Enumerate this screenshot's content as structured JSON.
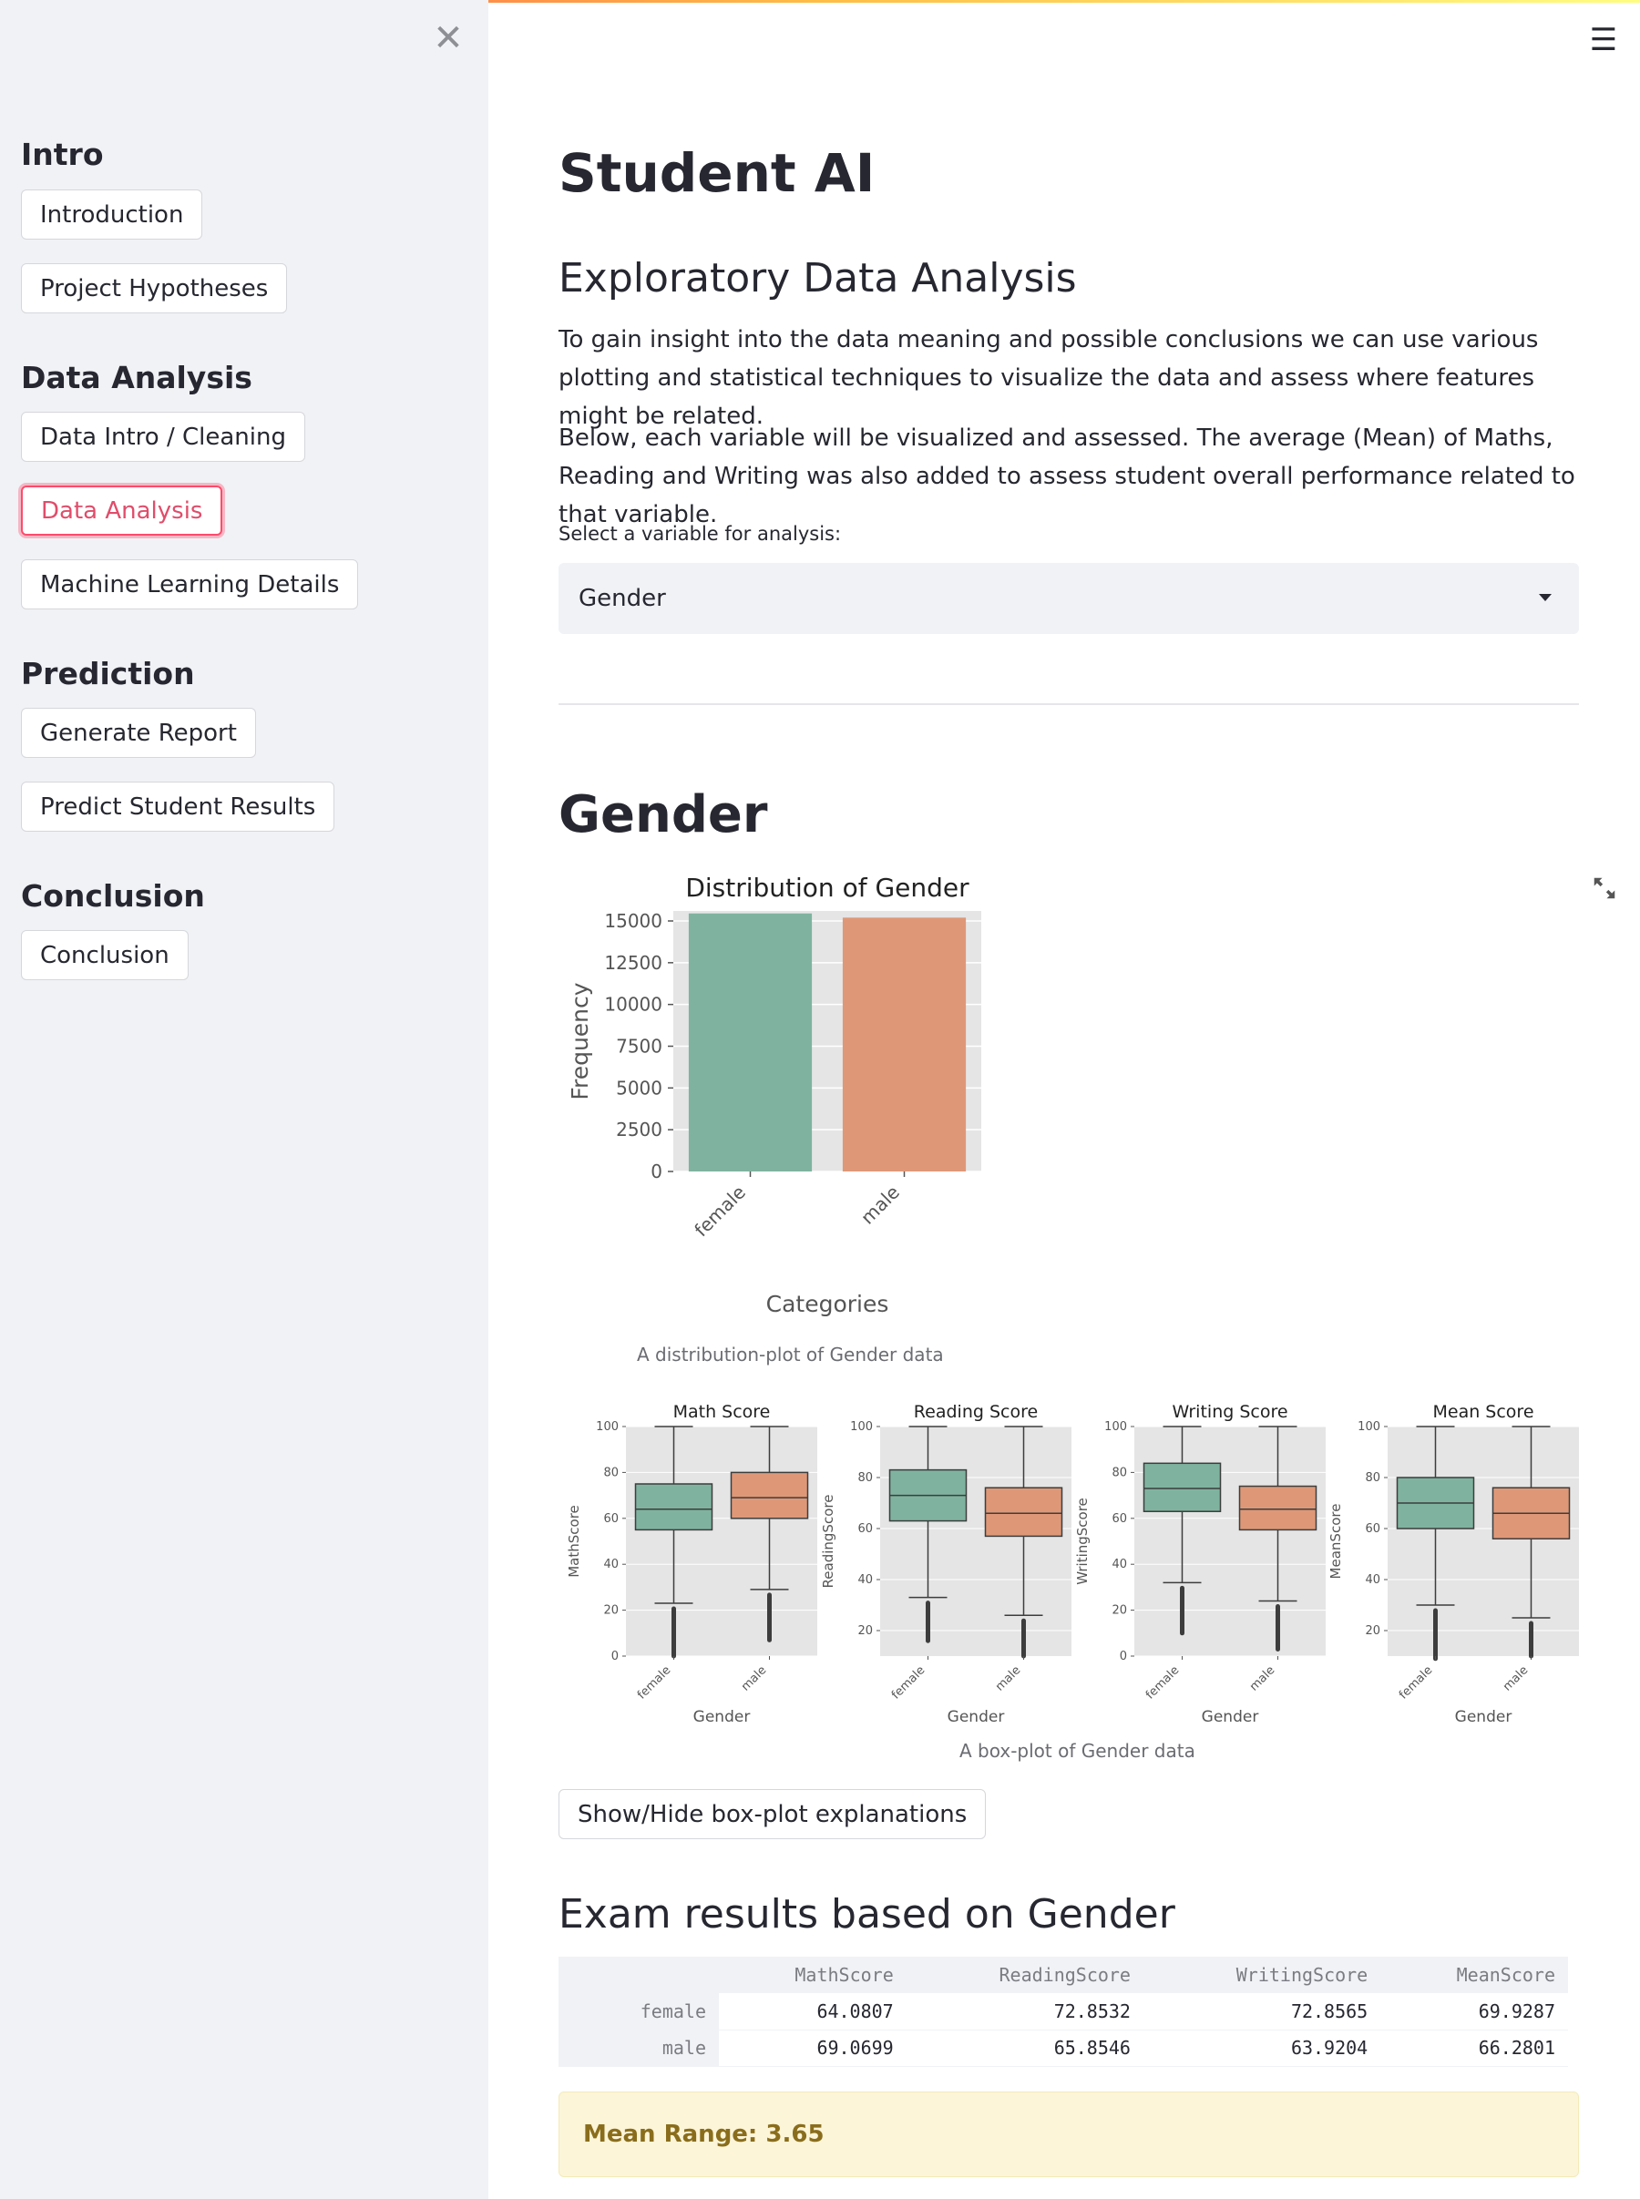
{
  "sidebar": {
    "sections": [
      {
        "heading": "Intro",
        "buttons": [
          "Introduction",
          "Project Hypotheses"
        ]
      },
      {
        "heading": "Data Analysis",
        "buttons": [
          "Data Intro / Cleaning",
          "Data Analysis",
          "Machine Learning Details"
        ]
      },
      {
        "heading": "Prediction",
        "buttons": [
          "Generate Report",
          "Predict Student Results"
        ]
      },
      {
        "heading": "Conclusion",
        "buttons": [
          "Conclusion"
        ]
      }
    ],
    "active_button": "Data Analysis"
  },
  "icons": {
    "close": "close-icon",
    "menu": "hamburger-icon",
    "expand": "fullscreen-icon"
  },
  "main": {
    "title": "Student AI",
    "subtitle": "Exploratory Data Analysis",
    "para1": "To gain insight into the data meaning and possible conclusions we can use various plotting and statistical techniques to visualize the data and assess where features might be related.",
    "para2": "Below, each variable will be visualized and assessed. The average (Mean) of Maths, Reading and Writing was also added to assess student overall performance related to that variable.",
    "select_label": "Select a variable for analysis:",
    "select_value": "Gender",
    "section_title": "Gender",
    "dist_caption": "A distribution-plot of Gender data",
    "box_caption": "A box-plot of Gender data",
    "toggle_button": "Show/Hide box-plot explanations",
    "results_title": "Exam results based on Gender",
    "table": {
      "columns": [
        "MathScore",
        "ReadingScore",
        "WritingScore",
        "MeanScore"
      ],
      "rows": [
        {
          "index": "female",
          "values": [
            "64.0807",
            "72.8532",
            "72.8565",
            "69.9287"
          ]
        },
        {
          "index": "male",
          "values": [
            "69.0699",
            "65.8546",
            "63.9204",
            "66.2801"
          ]
        }
      ]
    },
    "alert": "Mean Range: 3.65"
  },
  "colors": {
    "female": "#7fb3a0",
    "male": "#de9878",
    "accent": "#ff4b4b"
  },
  "chart_data": [
    {
      "type": "bar",
      "title": "Distribution of Gender",
      "xlabel": "Categories",
      "ylabel": "Frequency",
      "categories": [
        "female",
        "male"
      ],
      "values": [
        15450,
        15200
      ],
      "ylim": [
        0,
        15600
      ],
      "yticks": [
        "0",
        "2500",
        "5000",
        "7500",
        "10000",
        "12500",
        "15000"
      ]
    },
    {
      "type": "box",
      "title": "Math Score",
      "xlabel": "Gender",
      "ylabel": "MathScore",
      "categories": [
        "female",
        "male"
      ],
      "ylim": [
        0,
        100
      ],
      "yticks": [
        "0",
        "20",
        "40",
        "60",
        "80",
        "100"
      ],
      "boxes": [
        {
          "whislo": 23,
          "q1": 55,
          "med": 64,
          "q3": 75,
          "whishi": 100,
          "fliers_min": 0
        },
        {
          "whislo": 29,
          "q1": 60,
          "med": 69,
          "q3": 80,
          "whishi": 100,
          "fliers_min": 7
        }
      ]
    },
    {
      "type": "box",
      "title": "Reading Score",
      "xlabel": "Gender",
      "ylabel": "ReadingScore",
      "categories": [
        "female",
        "male"
      ],
      "ylim": [
        10,
        100
      ],
      "yticks": [
        "20",
        "40",
        "60",
        "80",
        "100"
      ],
      "boxes": [
        {
          "whislo": 33,
          "q1": 63,
          "med": 73,
          "q3": 83,
          "whishi": 100,
          "fliers_min": 16
        },
        {
          "whislo": 26,
          "q1": 57,
          "med": 66,
          "q3": 76,
          "whishi": 100,
          "fliers_min": 10
        }
      ]
    },
    {
      "type": "box",
      "title": "Writing Score",
      "xlabel": "Gender",
      "ylabel": "WritingScore",
      "categories": [
        "female",
        "male"
      ],
      "ylim": [
        0,
        100
      ],
      "yticks": [
        "0",
        "20",
        "40",
        "60",
        "80",
        "100"
      ],
      "boxes": [
        {
          "whislo": 32,
          "q1": 63,
          "med": 73,
          "q3": 84,
          "whishi": 100,
          "fliers_min": 10
        },
        {
          "whislo": 24,
          "q1": 55,
          "med": 64,
          "q3": 74,
          "whishi": 100,
          "fliers_min": 3
        }
      ]
    },
    {
      "type": "box",
      "title": "Mean Score",
      "xlabel": "Gender",
      "ylabel": "MeanScore",
      "categories": [
        "female",
        "male"
      ],
      "ylim": [
        10,
        100
      ],
      "yticks": [
        "20",
        "40",
        "60",
        "80",
        "100"
      ],
      "boxes": [
        {
          "whislo": 30,
          "q1": 60,
          "med": 70,
          "q3": 80,
          "whishi": 100,
          "fliers_min": 9
        },
        {
          "whislo": 25,
          "q1": 56,
          "med": 66,
          "q3": 76,
          "whishi": 100,
          "fliers_min": 10
        }
      ]
    }
  ]
}
